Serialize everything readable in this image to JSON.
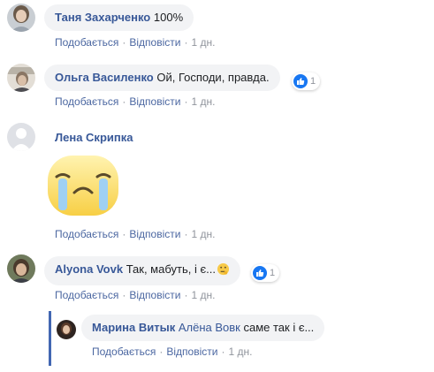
{
  "comments": [
    {
      "author": "Таня Захарченко",
      "text": "100%",
      "like_label": "Подобається",
      "reply_label": "Відповісти",
      "time": "1 дн."
    },
    {
      "author": "Ольга Василенко",
      "text": "Ой, Господи, правда.",
      "reaction_count": "1",
      "like_label": "Подобається",
      "reply_label": "Відповісти",
      "time": "1 дн."
    },
    {
      "author": "Лена Скрипка",
      "sticker": "crying-face-sticker",
      "like_label": "Подобається",
      "reply_label": "Відповісти",
      "time": "1 дн."
    },
    {
      "author": "Alyona Vovk",
      "text": "Так, мабуть, і є...",
      "reaction_count": "1",
      "like_label": "Подобається",
      "reply_label": "Відповісти",
      "time": "1 дн."
    }
  ],
  "reply": {
    "author": "Марина Витык",
    "mention": "Алёна Вовк",
    "text": "саме так і є...",
    "like_label": "Подобається",
    "reply_label": "Відповісти",
    "time": "1 дн."
  },
  "colors": {
    "name": "#385898",
    "link": "#4b67a1",
    "meta": "#90949c",
    "bubble": "#f2f3f5",
    "like_blue": "#1877f2",
    "reply_line": "#4267b2"
  },
  "icons": {
    "like": "thumbs-up-icon",
    "emoji": "thinking-face-emoji"
  }
}
